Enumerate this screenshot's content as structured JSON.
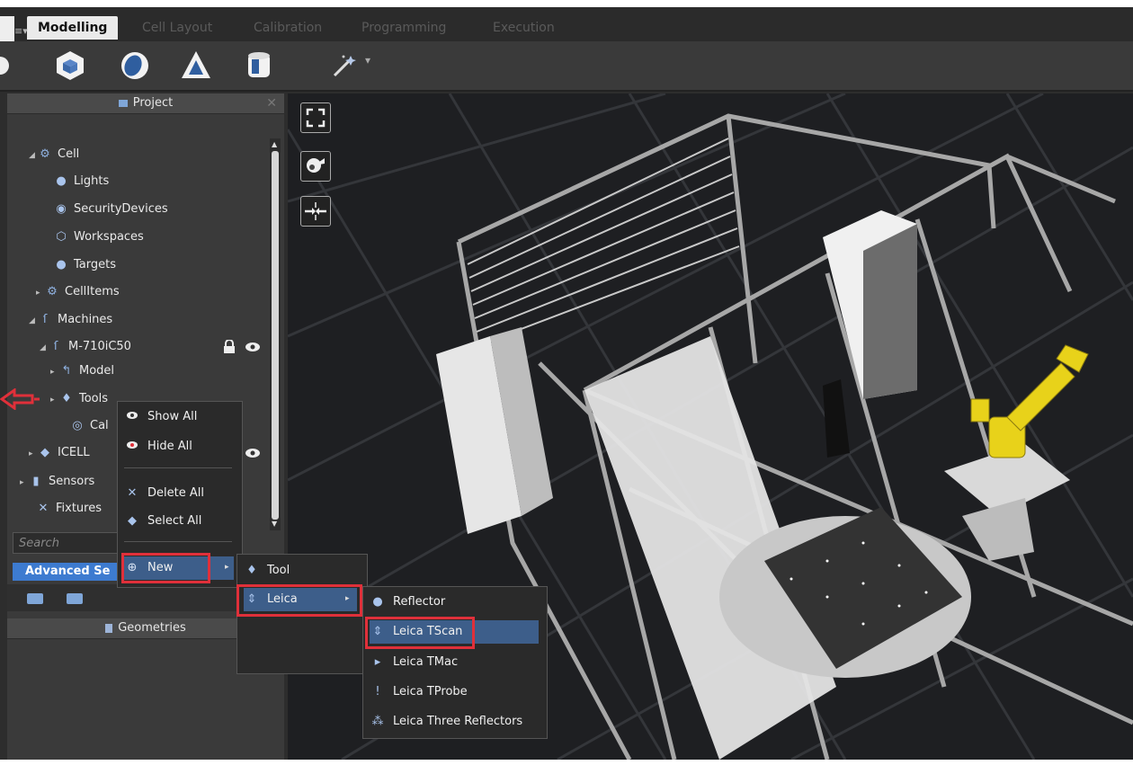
{
  "tabs": [
    {
      "label": "Modelling",
      "active": true
    },
    {
      "label": "Cell Layout",
      "active": false
    },
    {
      "label": "Calibration",
      "active": false
    },
    {
      "label": "Programming",
      "active": false
    },
    {
      "label": "Execution",
      "active": false
    }
  ],
  "toolbar": {
    "icons": [
      "cube-icon",
      "sphere-icon",
      "cone-icon",
      "cylinder-icon",
      "magic-wand-icon"
    ],
    "dropdown_glyph": "▾"
  },
  "project_panel": {
    "title": "Project",
    "close": "✕",
    "list_menu": "≡▾",
    "tree": [
      {
        "label": "Cell",
        "icon": "cell-icon",
        "expander": "◢"
      },
      {
        "label": "Lights",
        "icon": "light-bulb-icon",
        "expander": ""
      },
      {
        "label": "SecurityDevices",
        "icon": "security-icon",
        "expander": ""
      },
      {
        "label": "Workspaces",
        "icon": "workspace-icon",
        "expander": ""
      },
      {
        "label": "Targets",
        "icon": "target-icon",
        "expander": ""
      },
      {
        "label": "CellItems",
        "icon": "cell-items-icon",
        "expander": "▸"
      },
      {
        "label": "Machines",
        "icon": "machine-icon",
        "expander": "◢"
      },
      {
        "label": "M-710iC50",
        "icon": "robot-icon",
        "expander": "◢"
      },
      {
        "label": "Model",
        "icon": "model-icon",
        "expander": "▸"
      },
      {
        "label": "Tools",
        "icon": "tool-icon",
        "expander": "▸"
      },
      {
        "label": "Cal",
        "icon": "calibration-icon",
        "expander": ""
      },
      {
        "label": "ICELL",
        "icon": "icell-icon",
        "expander": "▸"
      },
      {
        "label": "Sensors",
        "icon": "sensor-icon",
        "expander": "▸"
      },
      {
        "label": "Fixtures",
        "icon": "fixture-icon",
        "expander": ""
      }
    ],
    "search_placeholder": "Search",
    "advanced_label": "Advanced Se"
  },
  "geometries_panel": {
    "title": "Geometries"
  },
  "context_menu": {
    "items": [
      {
        "label": "Show All",
        "icon": "eye-icon"
      },
      {
        "label": "Hide All",
        "icon": "hidden-eye-icon"
      },
      {
        "label": "Delete All",
        "icon": "close-icon"
      },
      {
        "label": "Select All",
        "icon": "select-icon"
      },
      {
        "label": "New",
        "icon": "plus-circle-icon"
      }
    ]
  },
  "submenu_new": {
    "items": [
      {
        "label": "Tool"
      },
      {
        "label": "Leica"
      }
    ]
  },
  "submenu_leica": {
    "items": [
      {
        "label": "Reflector"
      },
      {
        "label": "Leica TScan"
      },
      {
        "label": "Leica TMac"
      },
      {
        "label": "Leica TProbe"
      },
      {
        "label": "Leica Three Reflectors"
      }
    ]
  },
  "colors": {
    "highlight": "#e0303a",
    "accent": "#3d7bd0",
    "viewport": "#1e1f22",
    "robot": "#e8d21a"
  }
}
